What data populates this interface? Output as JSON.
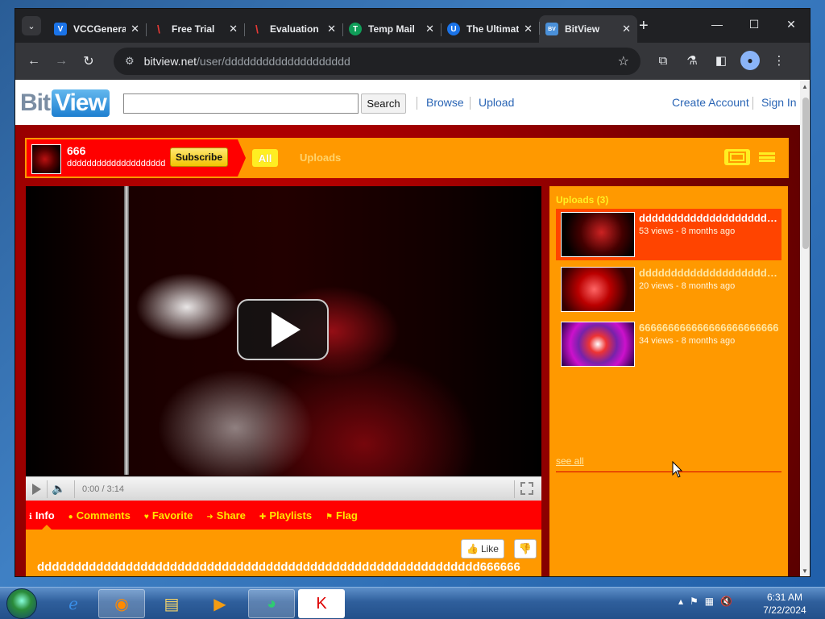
{
  "browser": {
    "tabs": [
      {
        "title": "VCCGenerator",
        "favicon": "V",
        "color": "#1a73e8"
      },
      {
        "title": "Free Trial",
        "favicon": "\\",
        "color": "#c5221f"
      },
      {
        "title": "Evaluation",
        "favicon": "\\",
        "color": "#c5221f"
      },
      {
        "title": "Temp Mail",
        "favicon": "T",
        "color": "#0f9d58"
      },
      {
        "title": "The Ultimate",
        "favicon": "U",
        "color": "#1a73e8"
      },
      {
        "title": "BitView",
        "favicon": "BV",
        "color": "#4a90d9"
      }
    ],
    "tab_menu_icon": "chevron-down-icon",
    "new_tab_label": "+",
    "url_host": "bitview.net",
    "url_path": "/user/dddddddddddddddddddd"
  },
  "site": {
    "logo_bit": "Bit",
    "logo_view": "View",
    "search_value": "",
    "search_button": "Search",
    "nav": {
      "browse": "Browse",
      "upload": "Upload",
      "create_account": "Create Account",
      "sign_in": "Sign In"
    }
  },
  "channel": {
    "name": "666",
    "username": "dddddddddddddddddddd",
    "subscribe_label": "Subscribe",
    "tabs": {
      "all": "All",
      "uploads": "Uploads"
    }
  },
  "player": {
    "time": "0:00 / 3:14"
  },
  "info_tabs": [
    {
      "label": "Info",
      "icon": "info-icon",
      "glyph": "ℹ"
    },
    {
      "label": "Comments",
      "icon": "comment-icon",
      "glyph": "●"
    },
    {
      "label": "Favorite",
      "icon": "heart-icon",
      "glyph": "♥"
    },
    {
      "label": "Share",
      "icon": "share-icon",
      "glyph": "➜"
    },
    {
      "label": "Playlists",
      "icon": "plus-icon",
      "glyph": "✚"
    },
    {
      "label": "Flag",
      "icon": "flag-icon",
      "glyph": "⚑"
    }
  ],
  "video": {
    "like_label": "Like",
    "title": "dddddddddddddddddddddddddddddddddddddddddddddddddddddddddddd666666"
  },
  "uploads": {
    "title": "Uploads (3)",
    "items": [
      {
        "title": "dddddddddddddddddddddd",
        "meta": "53 views - 8 months ago"
      },
      {
        "title": "dddddddddddddddddddddd",
        "meta": "20 views - 8 months ago"
      },
      {
        "title": "666666666666666666666666",
        "meta": "34 views - 8 months ago"
      }
    ],
    "see_all": "see all"
  },
  "taskbar": {
    "time": "6:31 AM",
    "date": "7/22/2024"
  }
}
